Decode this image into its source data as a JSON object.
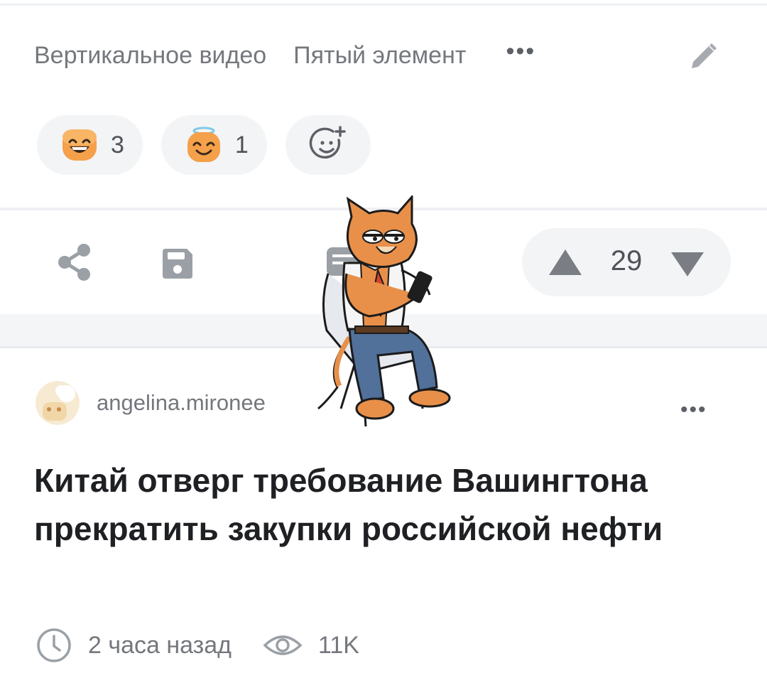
{
  "tags": {
    "items": [
      "Вертикальное видео",
      "Пятый элемент"
    ],
    "more_label": "•••"
  },
  "reactions": [
    {
      "emoji": "grinning-face-icon",
      "count": "3"
    },
    {
      "emoji": "smiling-face-with-halo-icon",
      "count": "1"
    }
  ],
  "actions": {
    "share": "share-icon",
    "save": "save-icon",
    "comments": "comments-icon",
    "rating": "29"
  },
  "post": {
    "author": "angelina.mironee",
    "more_label": "•••",
    "title": "Китай отверг требование Вашингтона прекратить закупки российской нефти",
    "time": "2 часа назад",
    "views": "11K"
  },
  "colors": {
    "muted_text": "#74777d",
    "pill_bg": "#f3f4f6",
    "icon_gray": "#9aa0a6",
    "emoji_orange": "#f59e42"
  }
}
